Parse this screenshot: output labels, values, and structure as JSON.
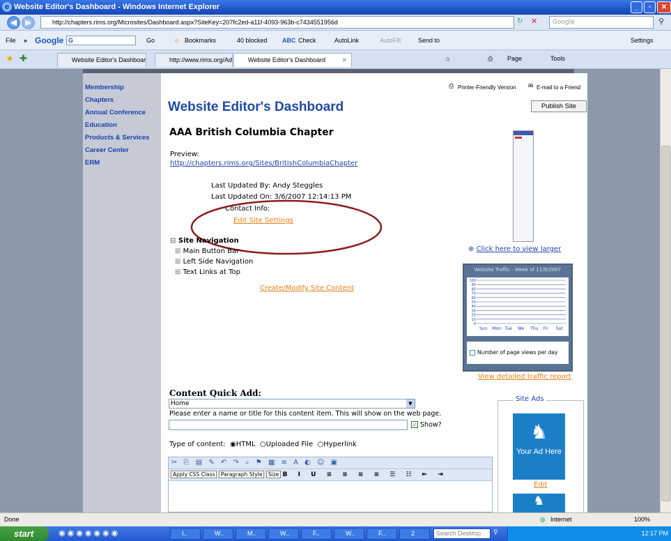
{
  "window": {
    "title": "Website Editor's Dashboard - Windows Internet Explorer"
  },
  "address": {
    "url": "http://chapters.rims.org/Microsites/Dashboard.aspx?SiteKey=207fc2ed-a11f-4093-963b-c7434551956d",
    "search_placeholder": "Google"
  },
  "toolbar": {
    "file": "File",
    "google": "Google",
    "google_g": "G",
    "go": "Go",
    "bookmarks": "Bookmarks",
    "blocked": "40 blocked",
    "check": "Check",
    "autolink": "AutoLink",
    "autofill": "AutoFill",
    "send_to": "Send to",
    "settings": "Settings"
  },
  "tabs": [
    {
      "label": "Website Editor's Dashboard"
    },
    {
      "label": "http://www.rims.org/AdminT..."
    },
    {
      "label": "Website Editor's Dashboard"
    }
  ],
  "tab_tools": {
    "page": "Page",
    "tools": "Tools"
  },
  "left_nav": [
    "Membership",
    "Chapters",
    "Annual Conference",
    "Education",
    "Products & Services",
    "Career Center",
    "ERM"
  ],
  "top_links": {
    "printer": "Printer-Friendly Version",
    "email": "E-mail to a Friend"
  },
  "publish_button": "Publish Site",
  "page_title": "Website Editor's Dashboard",
  "chapter_name": "AAA British Columbia Chapter",
  "preview": {
    "label": "Preview:",
    "url": "http://chapters.rims.org/Sites/BritishColumbiaChapter"
  },
  "info": {
    "updated_by": "Last Updated By: Andy Steggles",
    "updated_on": "Last Updated On: 3/6/2007 12:14:13 PM",
    "contact": "Contact Info:",
    "edit_settings": "Edit Site Settings"
  },
  "site_nav": {
    "title": "Site Navigation",
    "items": [
      "Main Button Bar",
      "Left Side Navigation",
      "Text Links at Top"
    ],
    "create_link": "Create/Modify Site Content"
  },
  "preview_panel": {
    "view_larger": "Click here to view larger"
  },
  "traffic": {
    "title": "Website Traffic - Week of 11/9/2007",
    "y_ticks": [
      "100",
      "90",
      "80",
      "70",
      "60",
      "50",
      "40",
      "30",
      "20",
      "10",
      "0"
    ],
    "days": [
      "Sun",
      "Mon",
      "Tue",
      "We",
      "Thu",
      "Fri",
      "Sat"
    ],
    "legend": "Number of page views per day",
    "report_link": "View detailed traffic report"
  },
  "quick_add": {
    "title": "Content Quick Add:",
    "select_value": "Home",
    "instruction": "Please enter a name or title for this content item. This will show on the web page.",
    "title_value": "",
    "show_label": "Show?",
    "type_label": "Type of content:",
    "types": [
      "HTML",
      "Uploaded File",
      "Hyperlink"
    ],
    "editor": {
      "css_class": "Apply CSS Class",
      "paragraph": "Paragraph Style",
      "size": "Size"
    }
  },
  "site_ads": {
    "title": "Site Ads",
    "ad_text": "Your Ad Here",
    "edit": "Edit"
  },
  "status": {
    "text": "Done",
    "zone": "Internet",
    "zoom": "100%"
  },
  "taskbar": {
    "start": "start",
    "buttons": [
      "I..",
      "W..",
      "M..",
      "W..",
      "F..",
      "W..",
      "F..",
      "2"
    ],
    "search": "Search Desktop",
    "time": "12:17 PM"
  },
  "colors": {
    "accent_blue": "#1f56c9",
    "link_orange": "#ea7f16",
    "nav_blue": "#1c3fa8",
    "ad_blue": "#1a7fc6",
    "annotation_red": "#8a1c1c"
  }
}
